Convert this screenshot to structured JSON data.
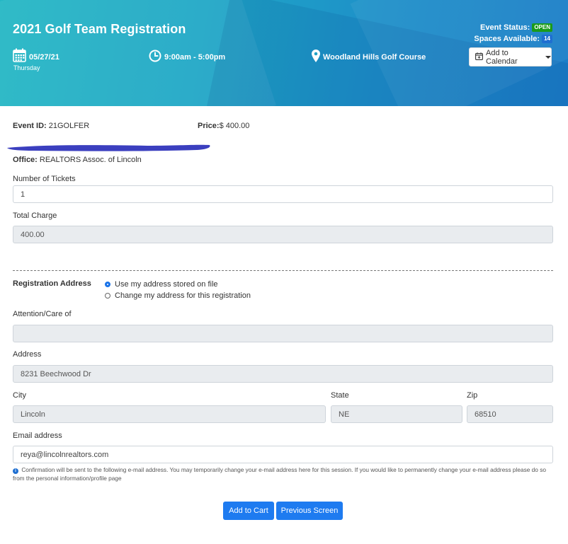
{
  "header": {
    "title": "2021 Golf Team Registration",
    "status_label": "Event Status:",
    "status_value": "OPEN",
    "spaces_label": "Spaces Available:",
    "spaces_value": "14",
    "date": "05/27/21",
    "weekday": "Thursday",
    "time": "9:00am - 5:00pm",
    "location": "Woodland Hills Golf Course",
    "calendar_button": "Add to Calendar"
  },
  "event": {
    "id_label": "Event ID:",
    "id_value": "21GOLFER",
    "price_label": "Price:",
    "price_value": "$ 400.00",
    "office_label": "Office:",
    "office_value": "REALTORS Assoc. of Lincoln"
  },
  "form": {
    "tickets_label": "Number of Tickets",
    "tickets_value": "1",
    "total_label": "Total Charge",
    "total_value": "400.00",
    "reg_address_label": "Registration Address",
    "radio_use_file": "Use my address stored on file",
    "radio_change": "Change my address for this registration",
    "attention_label": "Attention/Care of",
    "attention_value": "",
    "address_label": "Address",
    "address_value": "8231 Beechwood Dr",
    "city_label": "City",
    "city_value": "Lincoln",
    "state_label": "State",
    "state_value": "NE",
    "zip_label": "Zip",
    "zip_value": "68510",
    "email_label": "Email address",
    "email_value": "reya@lincolnrealtors.com",
    "note": "Confirmation will be sent to the following e-mail address. You may temporarily change your e-mail address here for this session. If you would like to permanently change your e-mail address please do so from the personal information/profile page"
  },
  "actions": {
    "add_to_cart": "Add to Cart",
    "previous": "Previous Screen"
  },
  "colors": {
    "accent": "#1e7bf0",
    "open_badge": "#1a9b1a",
    "redaction": "#3b3fbf"
  }
}
